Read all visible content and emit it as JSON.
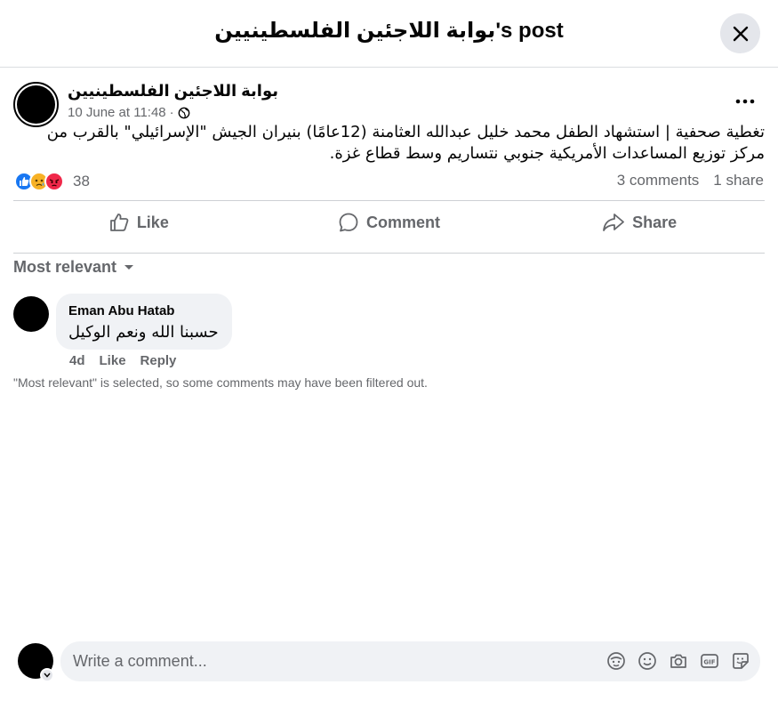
{
  "header": {
    "title": "بوابة اللاجئين الفلسطينيين's post"
  },
  "post": {
    "author": "بوابة اللاجئين الفلسطينيين",
    "timestamp": "10 June at 11:48",
    "separator": "·",
    "text": "تغطية صحفية | استشهاد الطفل محمد خليل عبدالله العثامنة (12عامًا) بنيران الجيش \"الإسرائيلي\" بالقرب من مركز توزيع المساعدات الأمريكية جنوبي نتساريم وسط قطاع غزة.",
    "reactions": {
      "icons": [
        "like-reaction-icon",
        "sad-reaction-icon",
        "angry-reaction-icon"
      ],
      "count": "38"
    },
    "comments_count": "3 comments",
    "shares_count": "1 share"
  },
  "actions": {
    "like": "Like",
    "comment": "Comment",
    "share": "Share"
  },
  "sort": {
    "label": "Most relevant"
  },
  "comments": [
    {
      "author": "Eman Abu Hatab",
      "text": "حسبنا الله ونعم الوكيل",
      "age": "4d",
      "like": "Like",
      "reply": "Reply"
    }
  ],
  "filter_note": "\"Most relevant\" is selected, so some comments may have been filtered out.",
  "composer": {
    "placeholder": "Write a comment..."
  },
  "colors": {
    "like_blue": "#1877f2",
    "angry_red": "#f0284a",
    "sad_yellow": "#f7b125",
    "muted": "#65676b"
  }
}
